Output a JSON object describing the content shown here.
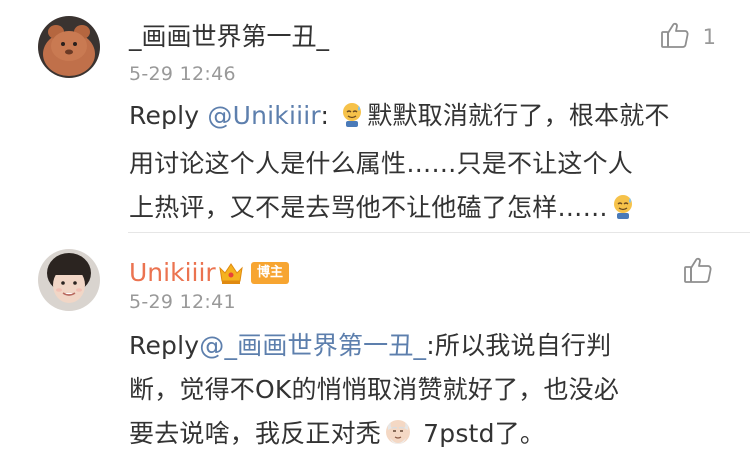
{
  "comments": [
    {
      "username": "_画画世界第一丑_",
      "time": "5-29 12:46",
      "like_count": "1",
      "body": {
        "reply_prefix": "Reply ",
        "mention": "@Unikiiir",
        "after_mention": ": ",
        "line1_rest": "默默取消就行了，根本就不",
        "line2": "用讨论这个人是什么属性……只是不让这个人",
        "line3": "上热评，又不是去骂他不让他磕了怎样……"
      }
    },
    {
      "username": "Unikiiir",
      "badge_label": "博主",
      "time": "5-29 12:41",
      "like_count": "",
      "body": {
        "reply_prefix": "Reply",
        "mention": "@_画画世界第一丑_",
        "line1_rest": ":所以我说自行判",
        "line2": "断，觉得不OK的悄悄取消赞就好了，也没必",
        "line3_a": "要去说啥，我反正对秃",
        "line3_b": " 7pstd了。"
      }
    }
  ],
  "colors": {
    "mention": "#5d7fad",
    "author_name": "#eb7350",
    "badge": "#f7a531",
    "secondary_text": "#999999"
  },
  "icons": {
    "like": "thumbs-up-icon",
    "emoji_sweat": "sweat-smile-emoji",
    "emoji_old_man": "old-man-emoji",
    "vip": "crown-vip-icon"
  }
}
